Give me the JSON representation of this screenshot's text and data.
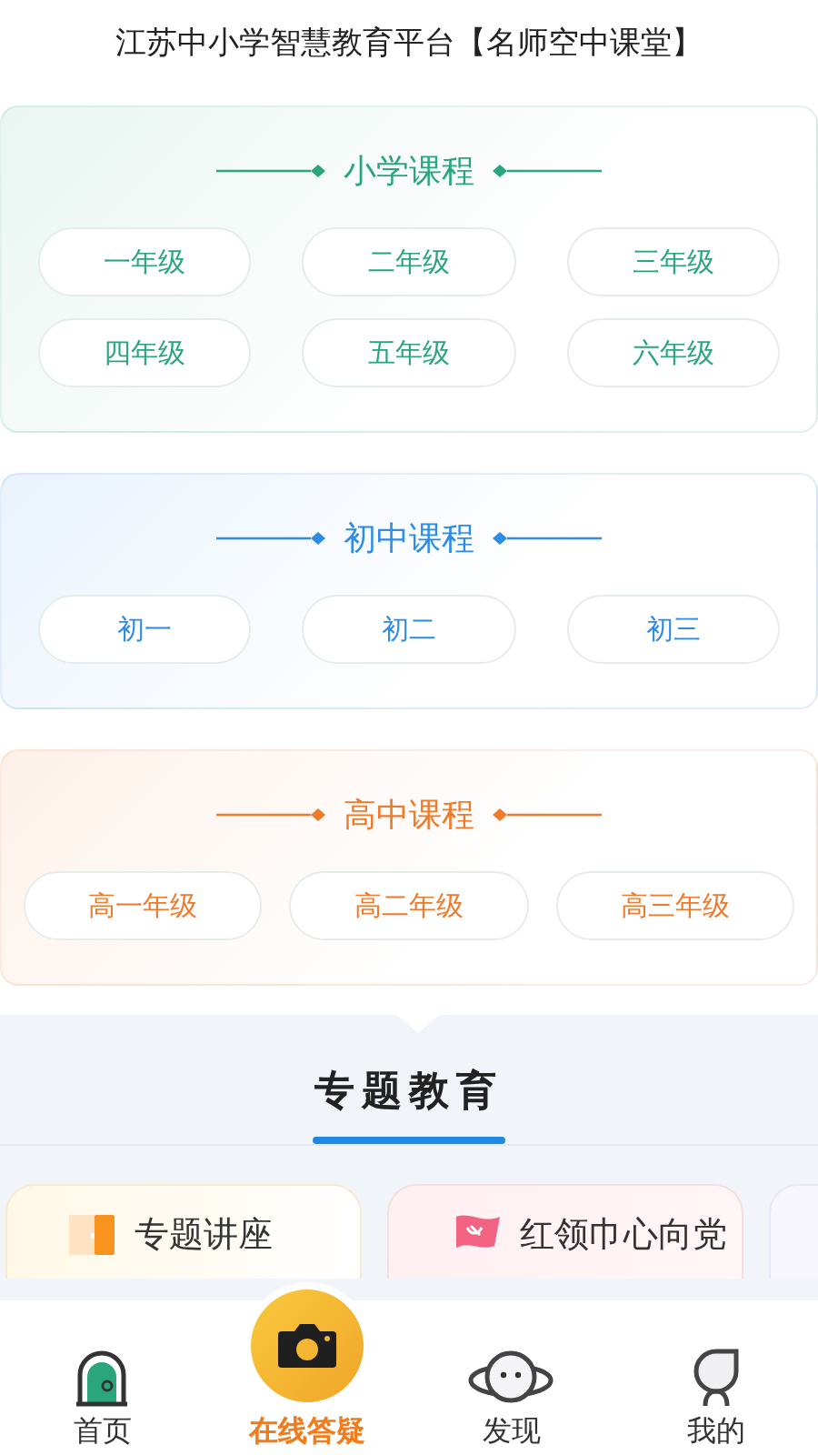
{
  "header": {
    "title": "江苏中小学智慧教育平台【名师空中课堂】"
  },
  "sections": [
    {
      "title": "小学课程",
      "color": "#2aa57c",
      "grades": [
        "一年级",
        "二年级",
        "三年级",
        "四年级",
        "五年级",
        "六年级"
      ]
    },
    {
      "title": "初中课程",
      "color": "#2e8be6",
      "grades": [
        "初一",
        "初二",
        "初三"
      ]
    },
    {
      "title": "高中课程",
      "color": "#ee7a2c",
      "grades": [
        "高一年级",
        "高二年级",
        "高三年级"
      ]
    }
  ],
  "topics": {
    "heading": "专题教育",
    "cards": [
      {
        "kind": "lecture",
        "label": "专题讲座"
      },
      {
        "kind": "flag",
        "label": "红领巾心向党"
      },
      {
        "kind": "blank"
      }
    ]
  },
  "nav": [
    {
      "kind": "home",
      "label": "首页",
      "selected": false
    },
    {
      "kind": "camera",
      "label": "在线答疑",
      "selected": true
    },
    {
      "kind": "discover",
      "label": "发现",
      "selected": false
    },
    {
      "kind": "me",
      "label": "我的",
      "selected": false
    }
  ]
}
